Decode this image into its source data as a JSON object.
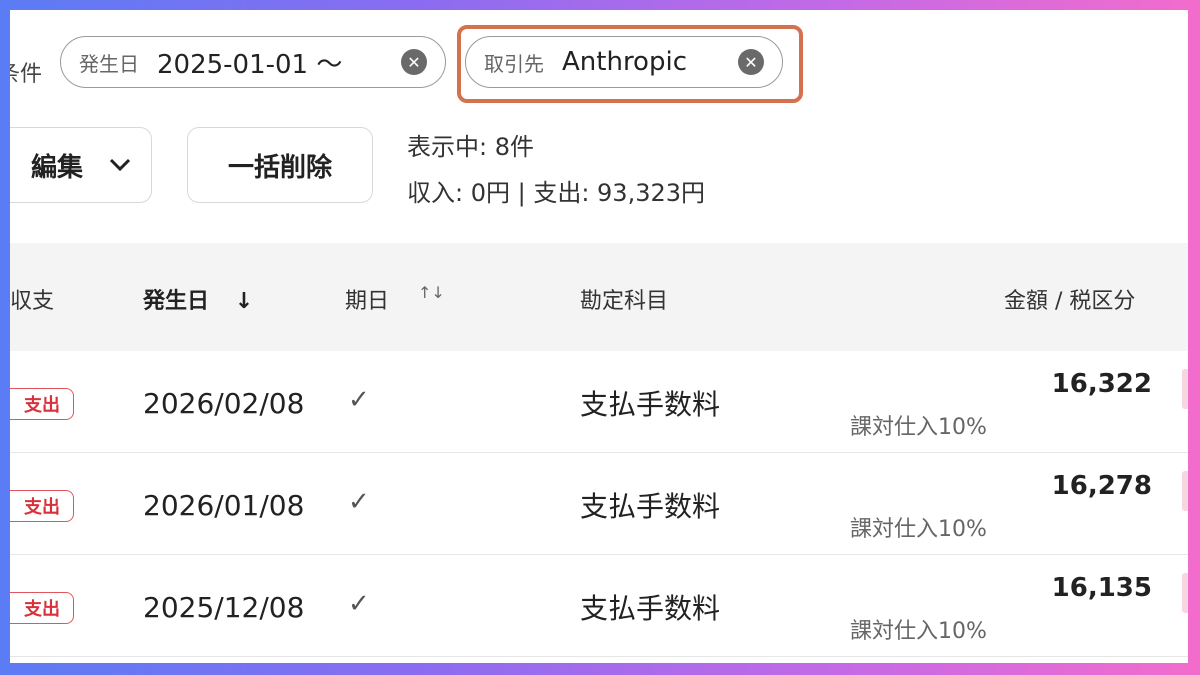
{
  "filters": {
    "label": "条件",
    "chips": [
      {
        "key": "発生日",
        "value": "2025-01-01 〜"
      },
      {
        "key": "取引先",
        "value": "Anthropic"
      }
    ]
  },
  "toolbar": {
    "edit_label": "編集",
    "bulk_delete_label": "一括削除",
    "showing": "表示中: 8件",
    "totals": "収入: 0円 | 支出: 93,323円"
  },
  "table": {
    "headers": {
      "type": "収支",
      "date": "発生日",
      "due": "期日",
      "account": "勘定科目",
      "amount": "金額 / 税区分"
    },
    "rows": [
      {
        "type": "支出",
        "date": "2026/02/08",
        "due_done": "✓",
        "account": "支払手数料",
        "amount": "16,322",
        "tax": "課対仕入10%"
      },
      {
        "type": "支出",
        "date": "2026/01/08",
        "due_done": "✓",
        "account": "支払手数料",
        "amount": "16,278",
        "tax": "課対仕入10%"
      },
      {
        "type": "支出",
        "date": "2025/12/08",
        "due_done": "✓",
        "account": "支払手数料",
        "amount": "16,135",
        "tax": "課対仕入10%"
      }
    ]
  },
  "colors": {
    "highlight": "#d4714f",
    "expense_badge": "#d8313a"
  }
}
